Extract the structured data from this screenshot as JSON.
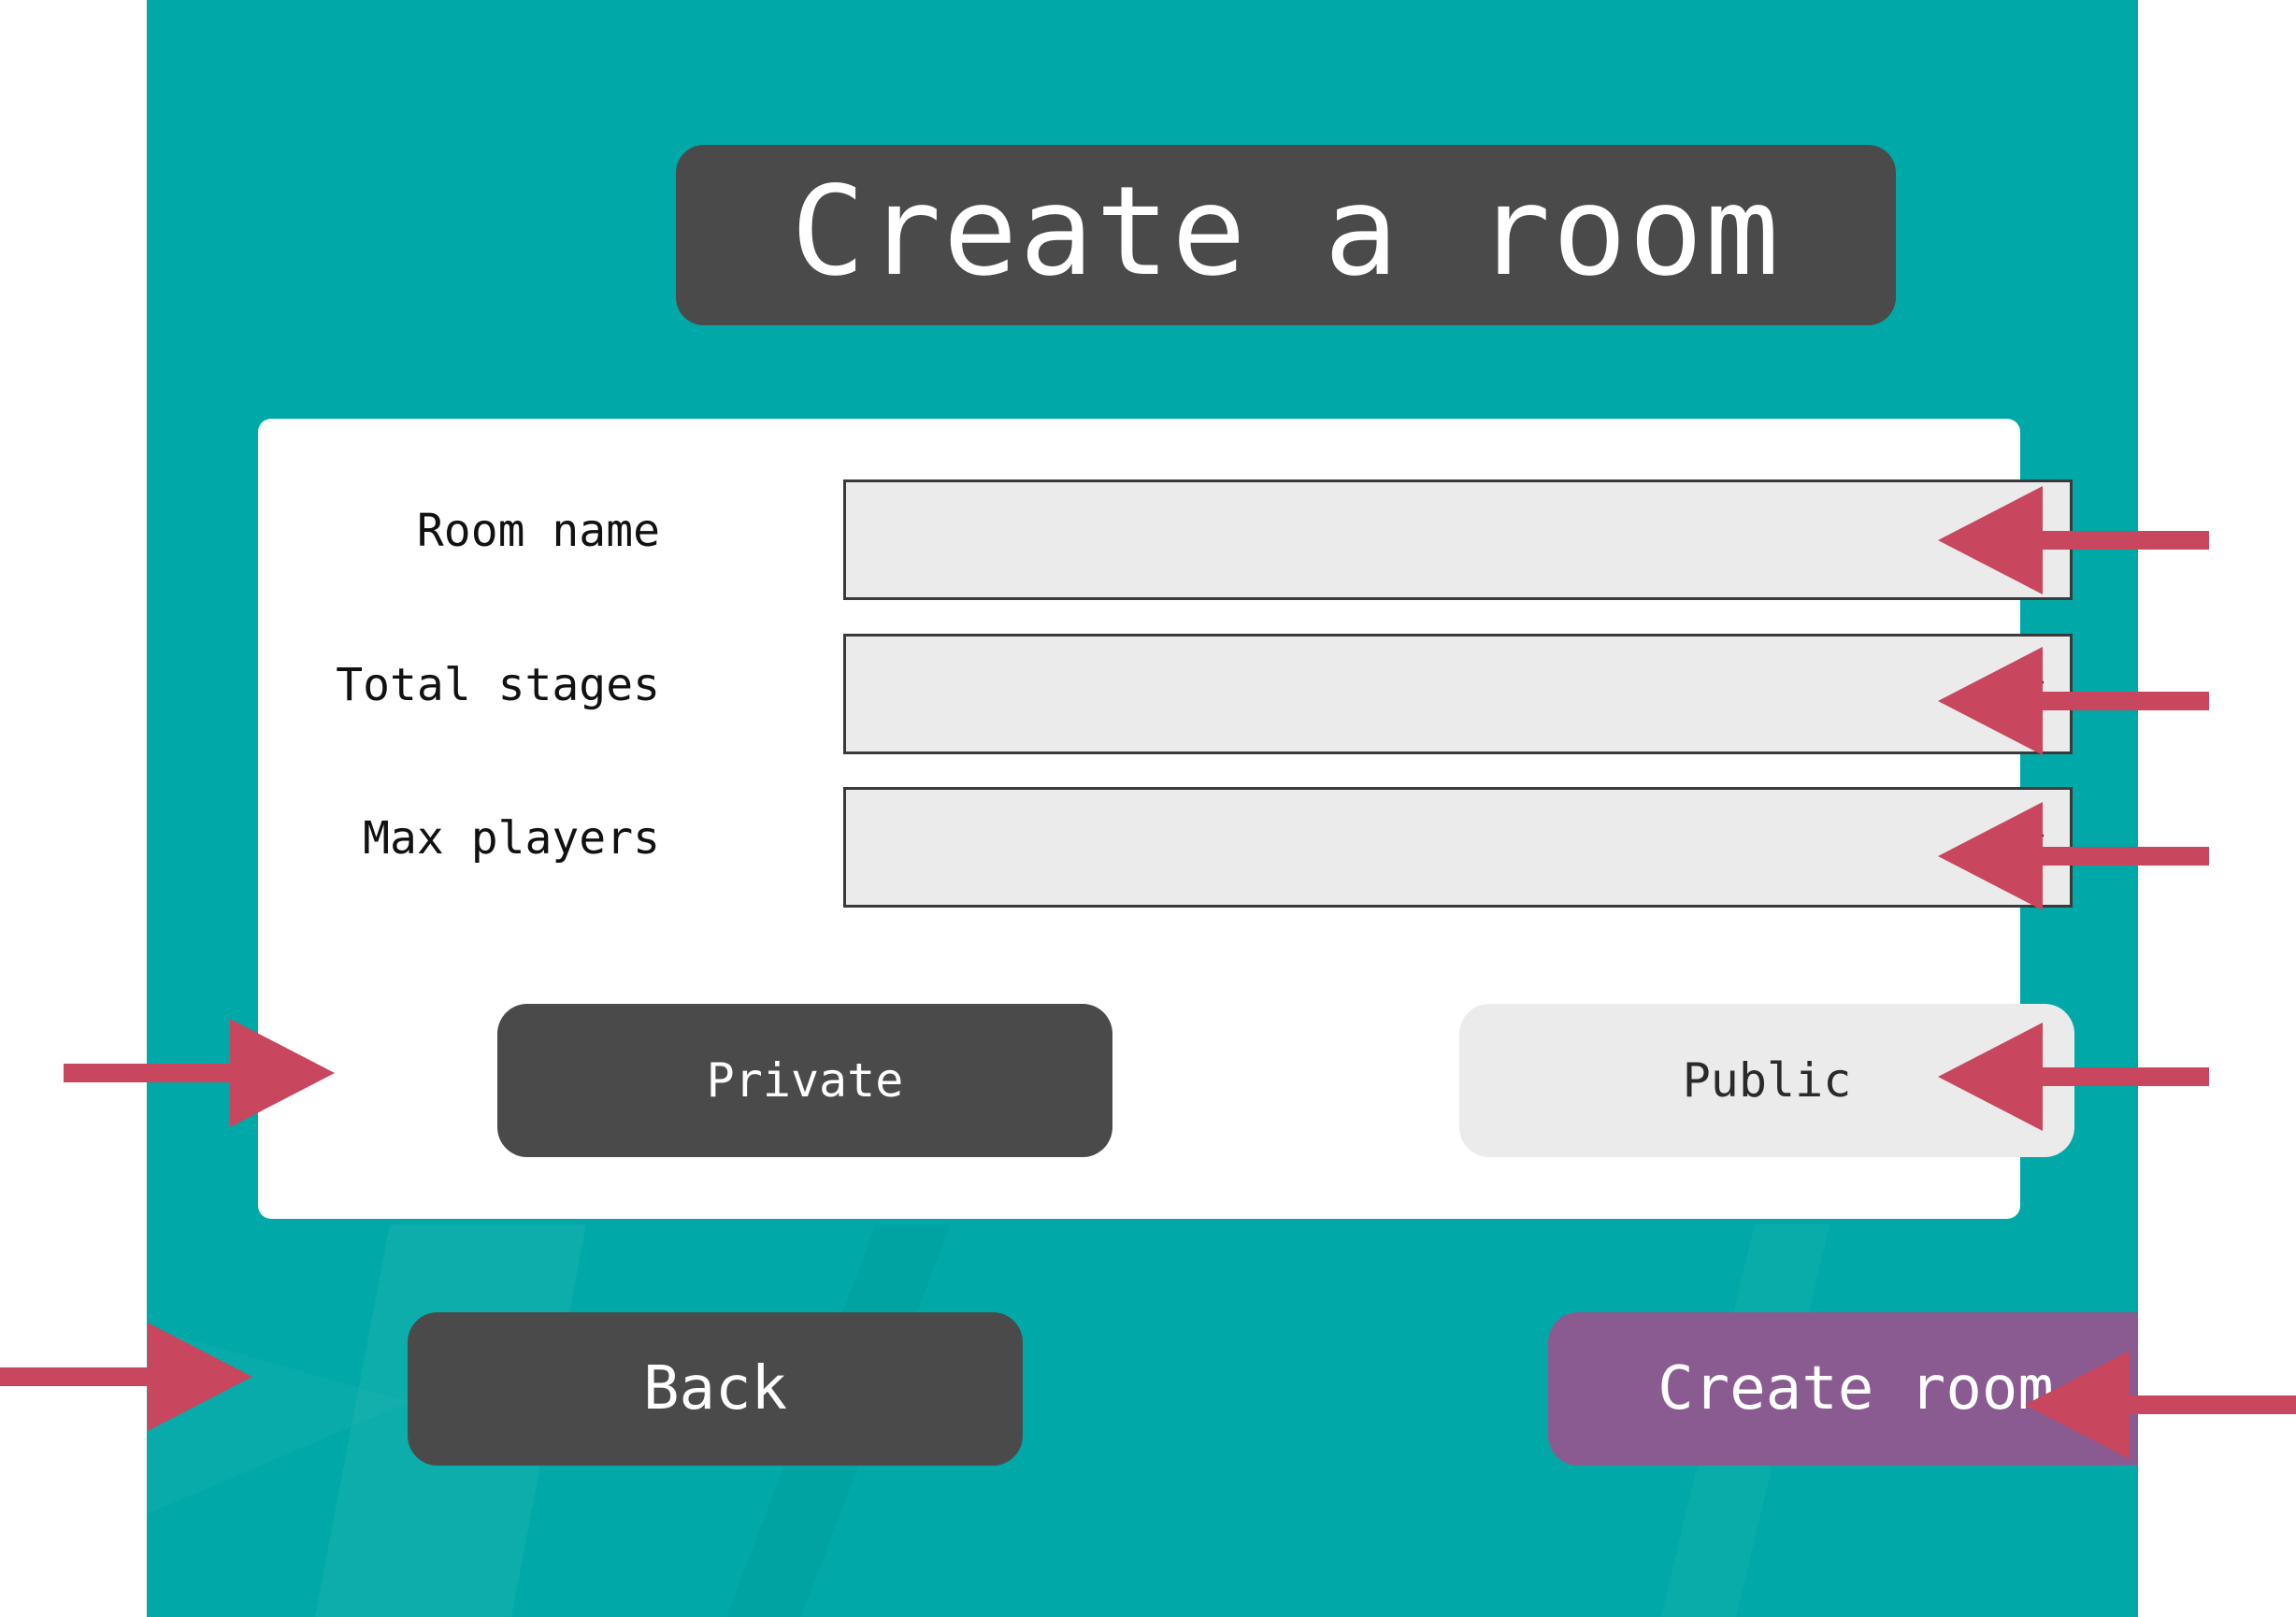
{
  "screen": {
    "title": "Create a room"
  },
  "form": {
    "room_name": {
      "label": "Room name",
      "value": "",
      "placeholder": ""
    },
    "total_stages": {
      "label": "Total stages",
      "selected": ""
    },
    "max_players": {
      "label": "Max players",
      "selected": ""
    },
    "visibility": {
      "private_label": "Private",
      "public_label": "Public",
      "selected": "Private"
    }
  },
  "actions": {
    "back_label": "Back",
    "create_label": "Create room"
  },
  "icons": {
    "select_chevron": "chevron-down-icon",
    "annotation": "arrow-icon"
  },
  "colors": {
    "panel_bg": "#00a9a7",
    "dark_button": "#4a4a4a",
    "light_button": "#ebebeb",
    "create_button": "#8a5b91",
    "annotation_arrow": "#c8465e"
  }
}
